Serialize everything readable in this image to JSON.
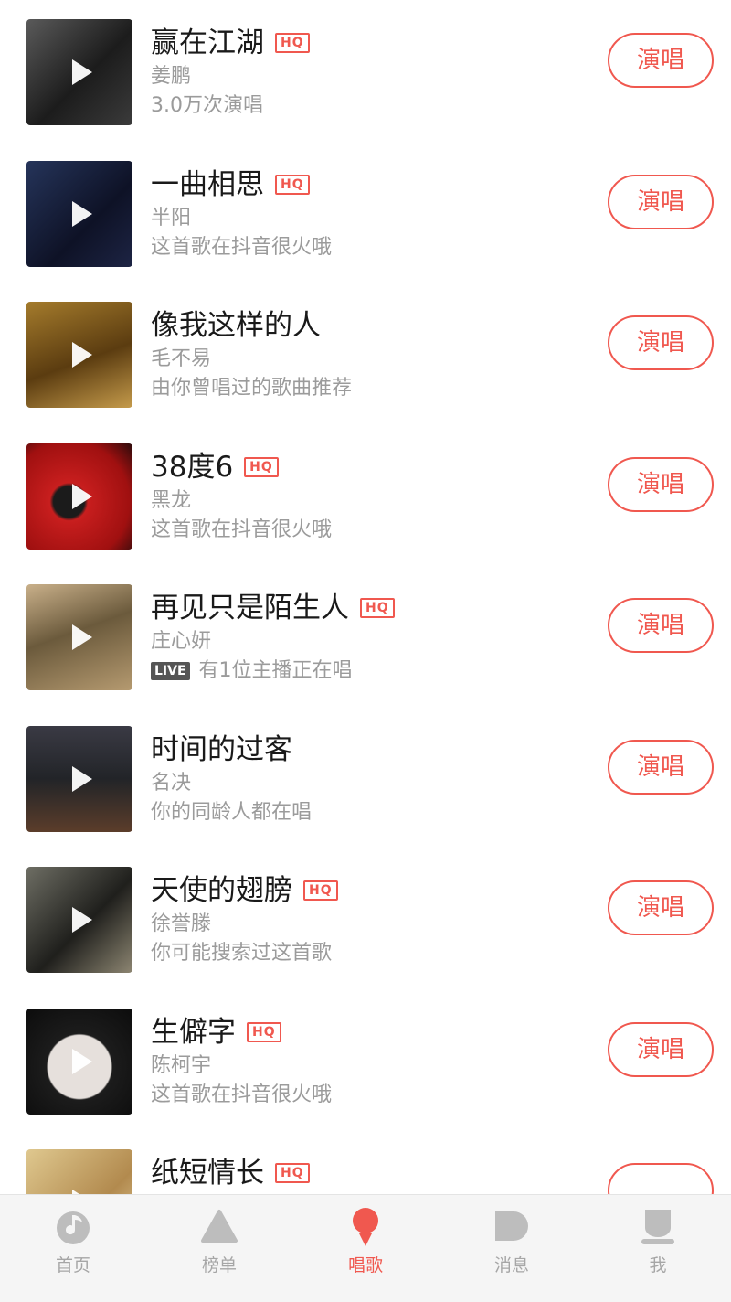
{
  "songs": [
    {
      "title": "赢在江湖",
      "hq": "HQ",
      "artist": "姜鹏",
      "sub": "3.0万次演唱",
      "live": null,
      "button": "演唱"
    },
    {
      "title": "一曲相思",
      "hq": "HQ",
      "artist": "半阳",
      "sub": "这首歌在抖音很火哦",
      "live": null,
      "button": "演唱"
    },
    {
      "title": "像我这样的人",
      "hq": null,
      "artist": "毛不易",
      "sub": "由你曾唱过的歌曲推荐",
      "live": null,
      "button": "演唱"
    },
    {
      "title": "38度6",
      "hq": "HQ",
      "artist": "黑龙",
      "sub": "这首歌在抖音很火哦",
      "live": null,
      "button": "演唱"
    },
    {
      "title": "再见只是陌生人",
      "hq": "HQ",
      "artist": "庄心妍",
      "sub": "有1位主播正在唱",
      "live": "LIVE",
      "button": "演唱"
    },
    {
      "title": "时间的过客",
      "hq": null,
      "artist": "名决",
      "sub": "你的同龄人都在唱",
      "live": null,
      "button": "演唱"
    },
    {
      "title": "天使的翅膀",
      "hq": "HQ",
      "artist": "徐誉滕",
      "sub": "你可能搜索过这首歌",
      "live": null,
      "button": "演唱"
    },
    {
      "title": "生僻字",
      "hq": "HQ",
      "artist": "陈柯宇",
      "sub": "这首歌在抖音很火哦",
      "live": null,
      "button": "演唱"
    },
    {
      "title": "纸短情长",
      "hq": "HQ",
      "artist": "",
      "sub": "",
      "live": null,
      "button": ""
    }
  ],
  "tabs": [
    {
      "label": "首页",
      "icon": "music-note-icon",
      "active": false
    },
    {
      "label": "榜单",
      "icon": "chart-triangle-icon",
      "active": false
    },
    {
      "label": "唱歌",
      "icon": "microphone-icon",
      "active": true
    },
    {
      "label": "消息",
      "icon": "message-bubble-icon",
      "active": false
    },
    {
      "label": "我",
      "icon": "profile-icon",
      "active": false
    }
  ],
  "colors": {
    "accent": "#f0584f",
    "muted": "#9b9b9b",
    "tab_inactive": "#bdbdbd"
  }
}
